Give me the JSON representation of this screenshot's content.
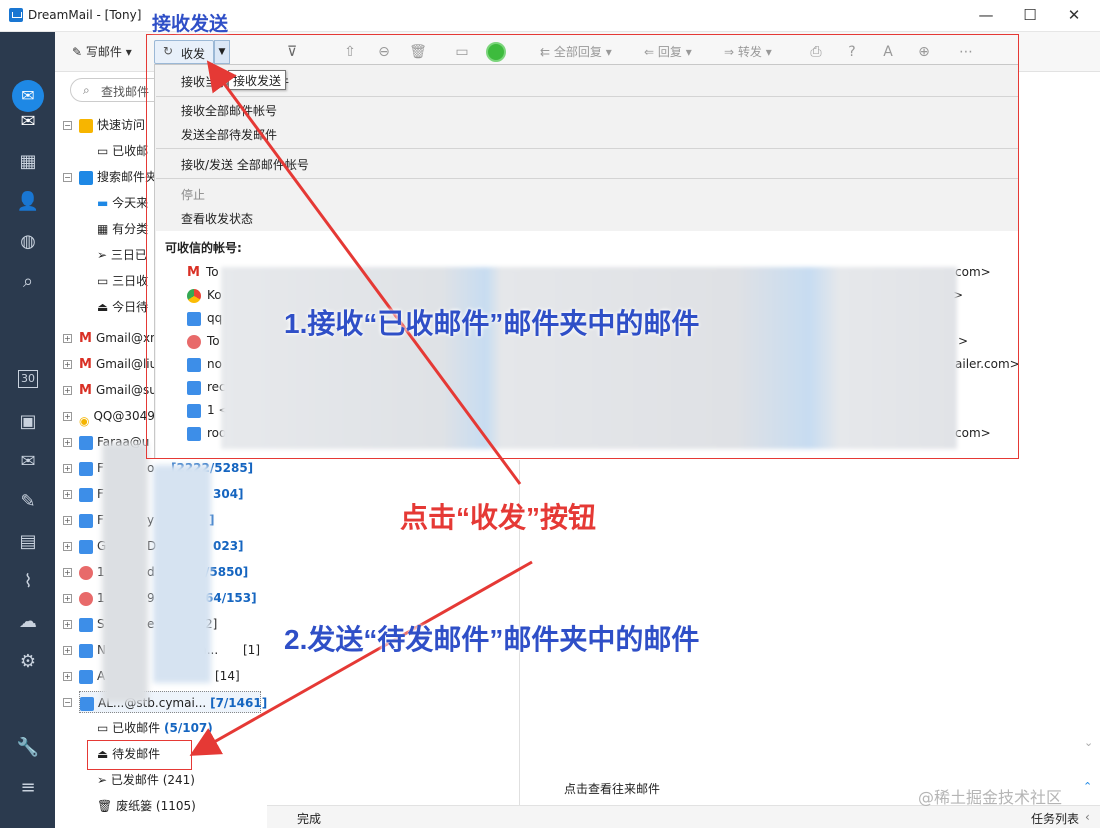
{
  "window": {
    "title": "DreamMail - [Tony]",
    "minimize": "—",
    "maximize": "☐",
    "close": "✕"
  },
  "sidebar": {
    "icons": [
      "logo-icon",
      "mail-icon",
      "calendar-grid-icon",
      "contacts-icon",
      "globe-icon",
      "search-icon",
      "calendar-30-icon",
      "address-book-icon",
      "mail-edit-icon",
      "pen-icon",
      "notes-icon",
      "attachment-icon",
      "cloud-icon",
      "gear-icon",
      "wrench-icon",
      "menu-icon"
    ],
    "calendar_day": "30"
  },
  "toolbar": {
    "compose": "写邮件",
    "receive": "收发",
    "reply_all": "全部回复",
    "reply": "回复",
    "forward": "转发"
  },
  "search": {
    "placeholder": "查找邮件"
  },
  "tree": {
    "quick_access": "快速访问",
    "inbox_short": "已收邮",
    "search_folders": "搜索邮件夹",
    "today": "今天来",
    "categorized": "有分类",
    "three_days_sent": "三日已",
    "three_days_recv": "三日收",
    "today_pending": "今日待",
    "gmail1": "Gmail@xn",
    "gmail2": "Gmail@liu",
    "gmail3": "Gmail@su",
    "qq": "QQ@3049",
    "acc_fa": "Faraa@u",
    "r1": {
      "lead": "F",
      "tail": "o",
      "cnt": "[2222/5285]"
    },
    "r2": {
      "lead": "F",
      "tail": "",
      "cnt": "304]"
    },
    "r3": {
      "lead": "F",
      "tail": "y",
      "cnt": "]"
    },
    "r4": {
      "lead": "G",
      "tail": "D",
      "cnt": "023]"
    },
    "r5": {
      "lead": "1",
      "tail": "d",
      "cnt": "/5850]"
    },
    "r6": {
      "lead": "1",
      "tail": "9",
      "cnt": "64/153]"
    },
    "r7": {
      "lead": "S",
      "tail": "e",
      "cnt": "2]"
    },
    "r8": {
      "lead": "N",
      "tail": "m...",
      "cnt": "[1]"
    },
    "r9": {
      "lead": "A",
      "tail": "",
      "cnt": "[14]"
    },
    "active_account": {
      "name": "AL...@stb.cymai...",
      "count": "[7/1461]"
    },
    "inbox": {
      "label": "已收邮件",
      "count": "(5/107)"
    },
    "outbox": "待发邮件",
    "sent": {
      "label": "已发邮件",
      "count": "(241)"
    },
    "trash": {
      "label": "废纸篓",
      "count": "(1105)"
    }
  },
  "menu": {
    "recv_current": "接收当前邮件夹邮件",
    "recv_all": "接收全部邮件帐号",
    "send_all": "发送全部待发邮件",
    "recv_send_all": "接收/发送 全部邮件帐号",
    "stop": "停止",
    "view_status": "查看收发状态",
    "accounts_header": "可收信的帐号:",
    "accounts": [
      "To",
      "Ko",
      "qq",
      "To",
      "no",
      "rec",
      "1 <",
      "roo"
    ],
    "accounts_right": [
      "com>",
      ">",
      "",
      ">",
      "ailer.com>",
      "",
      "",
      "com>"
    ]
  },
  "tooltip": "接收发送",
  "annotations": {
    "title_label": "接收发送",
    "step1": "1.接收“已收邮件”邮件夹中的邮件",
    "click": "点击“收发”按钮",
    "step2": "2.发送“待发邮件”邮件夹中的邮件"
  },
  "preview": {
    "link": "点击查看往来邮件"
  },
  "status": {
    "left": "完成",
    "right": "任务列表"
  },
  "watermark": "@稀土掘金技术社区",
  "colors": {
    "sidebar": "#2b3a4e",
    "accent": "#1e88e5",
    "annotation_red": "#e53935",
    "annotation_blue": "#2f4fc7"
  }
}
